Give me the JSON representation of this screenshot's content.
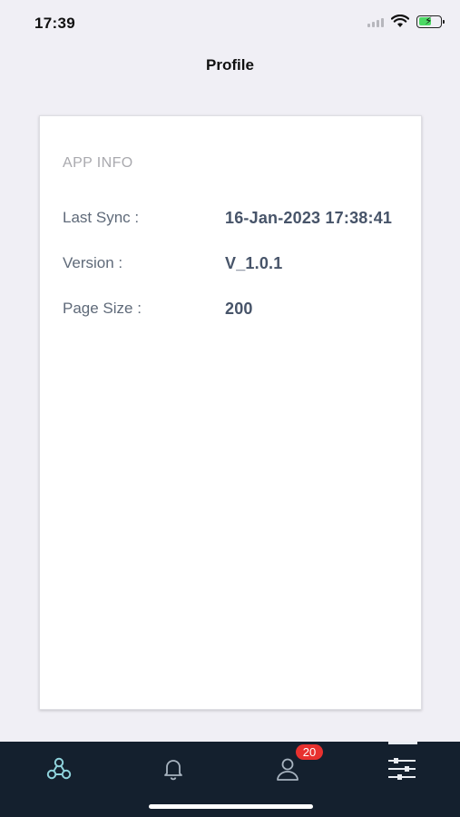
{
  "status_bar": {
    "time": "17:39"
  },
  "header": {
    "title": "Profile"
  },
  "app_info": {
    "section_title": "APP INFO",
    "rows": [
      {
        "label": "Last Sync :",
        "value": "16-Jan-2023 17:38:41"
      },
      {
        "label": "Version :",
        "value": "V_1.0.1"
      },
      {
        "label": "Page Size :",
        "value": "200"
      }
    ]
  },
  "tab_bar": {
    "tabs": [
      {
        "icon": "network-nodes-icon"
      },
      {
        "icon": "bell-icon"
      },
      {
        "icon": "user-icon",
        "badge": "20"
      },
      {
        "icon": "sliders-icon",
        "active": true
      }
    ]
  },
  "colors": {
    "background": "#f0eff5",
    "tab_bar": "#14202e",
    "badge": "#e8312f",
    "label": "#5f6a79",
    "value": "#475469",
    "section_title": "#a9a9ae"
  }
}
